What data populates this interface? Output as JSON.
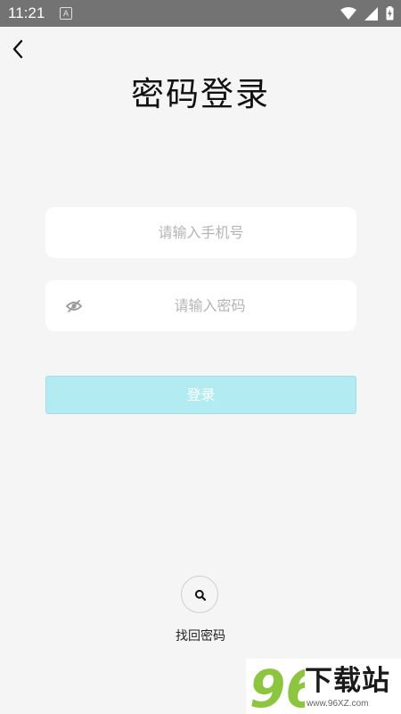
{
  "status_bar": {
    "time": "11:21",
    "notification_letter": "A",
    "icons": [
      "wifi-icon",
      "signal-icon",
      "battery-charging-icon"
    ]
  },
  "header": {
    "back_icon": "chevron-left-icon",
    "title": "密码登录"
  },
  "form": {
    "phone": {
      "value": "",
      "placeholder": "请输入手机号"
    },
    "password": {
      "value": "",
      "placeholder": "请输入密码",
      "toggle_icon": "eye-off-icon"
    },
    "login_label": "登录"
  },
  "recover": {
    "icon": "search-icon",
    "label": "找回密码"
  },
  "watermark": {
    "logo_text": "96",
    "text": "下载站",
    "url": "www.96XZ.com"
  },
  "colors": {
    "background": "#f5f5f5",
    "status_bar": "#737373",
    "login_button": "#b2ebf2",
    "placeholder": "#b4b4b4",
    "logo_green": "#8cc63f"
  }
}
